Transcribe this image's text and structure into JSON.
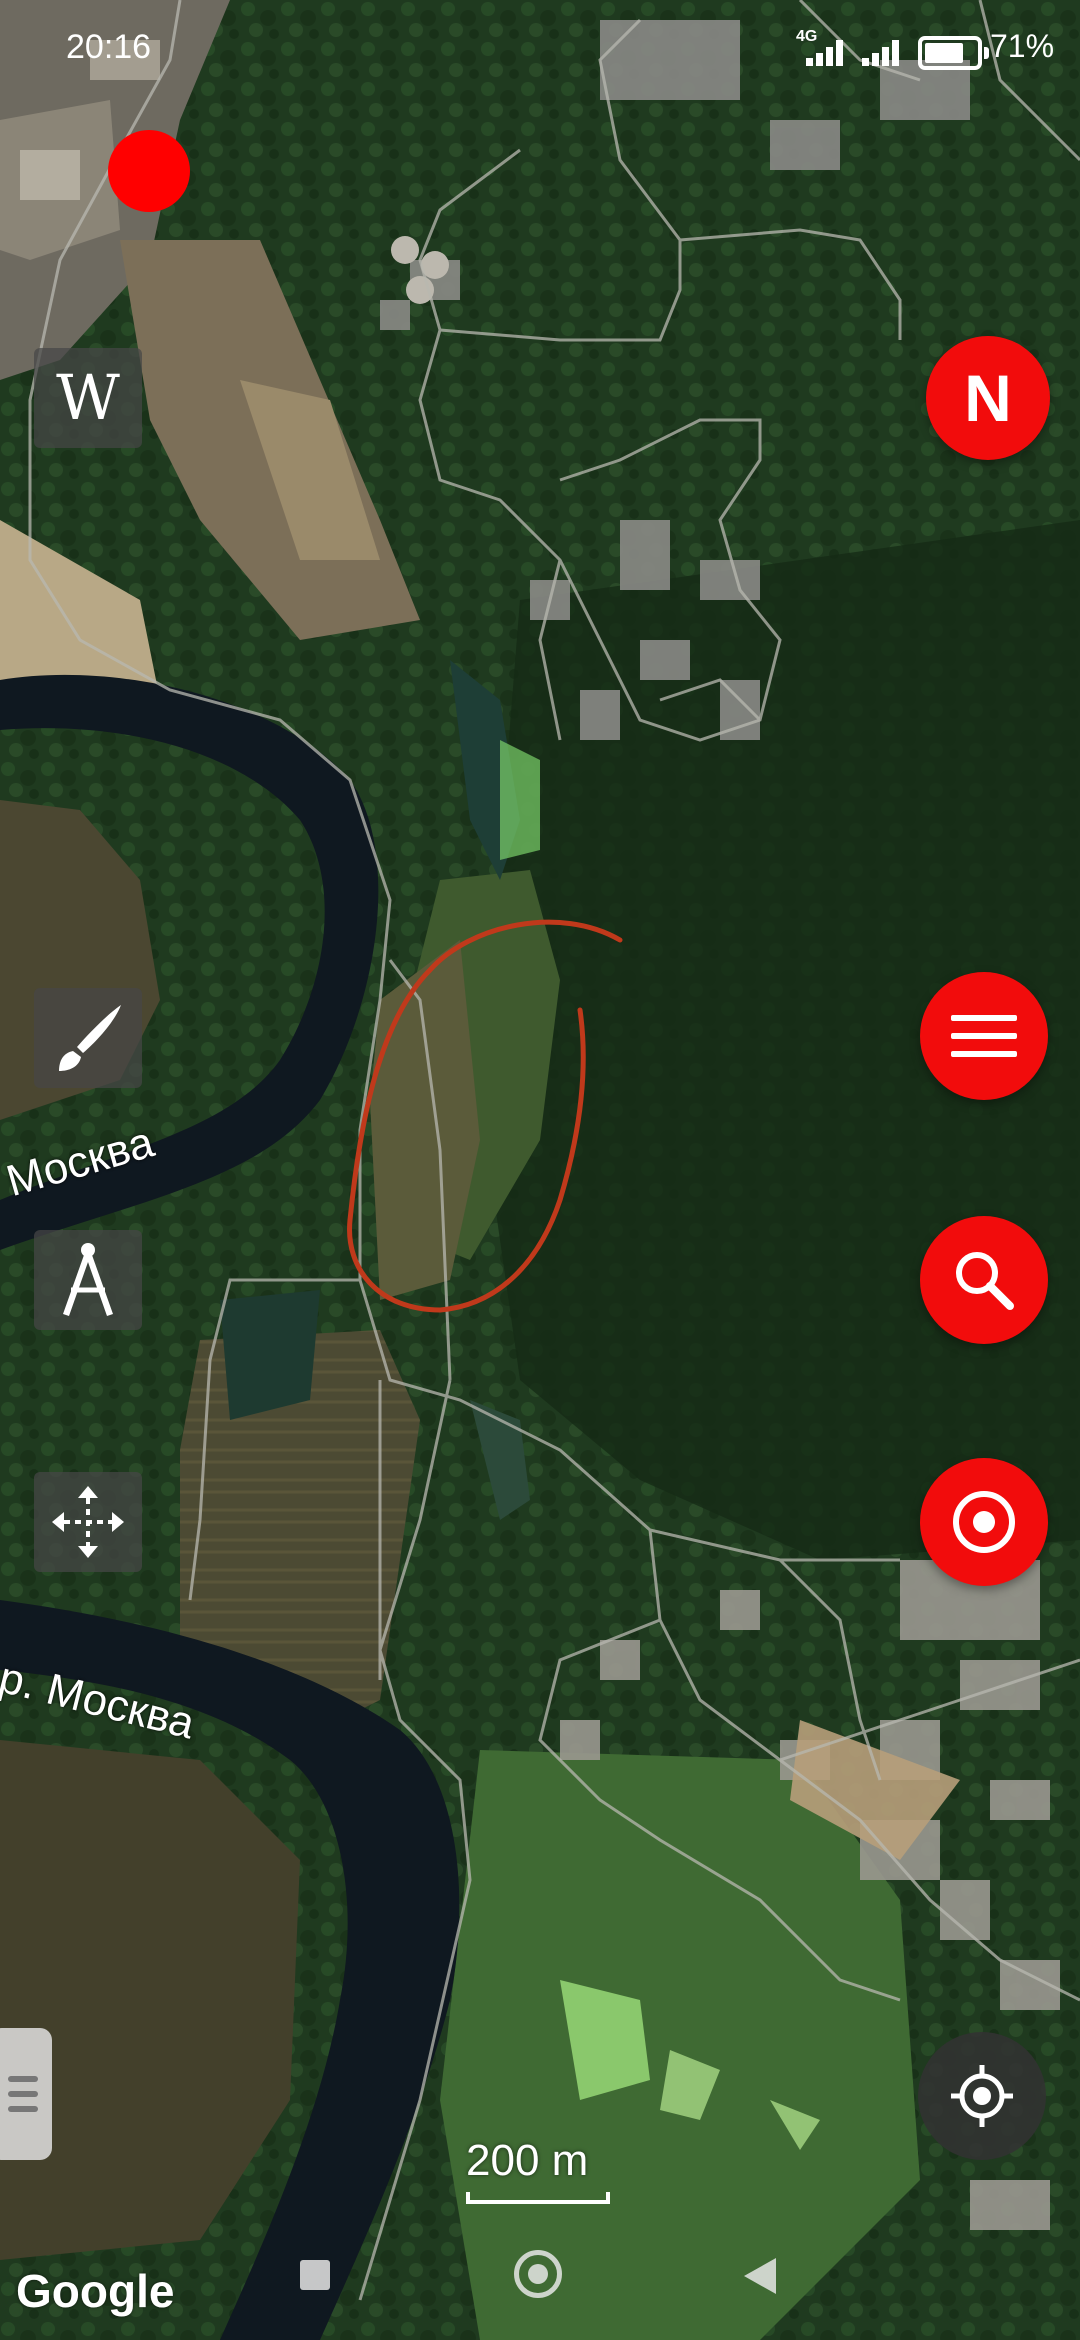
{
  "status_bar": {
    "time": "20:16",
    "network": "4G",
    "battery": "71"
  },
  "map": {
    "provider": "Google",
    "scale_label": "200 m",
    "labels": {
      "river_upper": "Москва",
      "river_lower": "р. Москва"
    },
    "annotation_color": "#c0391b"
  },
  "toolbar_left": {
    "wikipedia": "W",
    "items": [
      "wikipedia-icon",
      "brush-icon",
      "compass-icon",
      "move-icon"
    ]
  },
  "toolbar_right": {
    "north": "N",
    "items": [
      "menu-icon",
      "search-icon",
      "target-icon"
    ]
  },
  "colors": {
    "accent": "#f20c0c",
    "recording": "#ff0000"
  }
}
